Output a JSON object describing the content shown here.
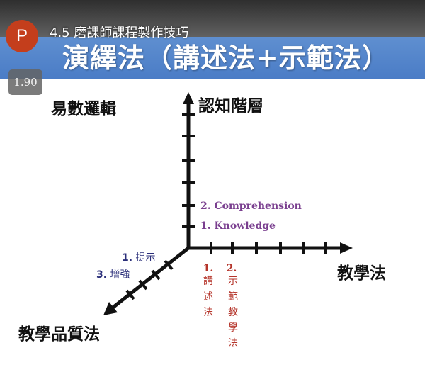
{
  "player": {
    "logo_letter": "P",
    "deck_title": "4.5 磨課師課程製作技巧",
    "speed": "1.90"
  },
  "slide": {
    "heading": "演繹法（講述法+示範法）",
    "left_title": "易數邏輯",
    "y_axis_label": "認知階層",
    "x_axis_label": "教學法",
    "z_axis_label": "教學品質法",
    "y_levels": [
      "2. Comprehension",
      "1. Knowledge"
    ],
    "z_items": [
      {
        "num": "1.",
        "text": "提示"
      },
      {
        "num": "3.",
        "text": "增強"
      }
    ],
    "x_items": [
      {
        "num": "1.",
        "text": "講述法"
      },
      {
        "num": "2.",
        "text": "示範教學法"
      }
    ],
    "colors": {
      "axis": "#111111",
      "purple": "#7a3f8f",
      "navy": "#2b2f7a",
      "red": "#b5352b"
    }
  }
}
